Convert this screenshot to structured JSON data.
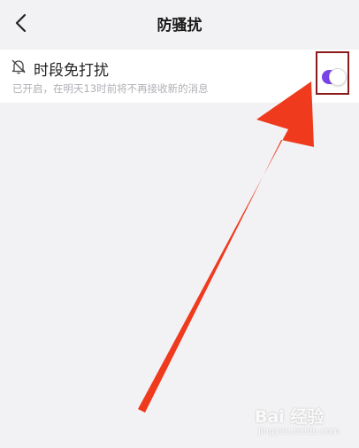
{
  "header": {
    "title": "防骚扰",
    "back_icon": "chevron-left-icon"
  },
  "setting": {
    "icon": "bell-off-icon",
    "title": "时段免打扰",
    "subtitle": "已开启，在明天13时前将不再接收新的消息",
    "toggle_on": true,
    "toggle_color": "#7a43e8"
  },
  "annotation": {
    "arrow_color": "#f03a1e",
    "box_color": "#8b1a1a"
  },
  "watermark": {
    "brand": "Bai  经验",
    "url": "jingyan.baidu.com"
  }
}
